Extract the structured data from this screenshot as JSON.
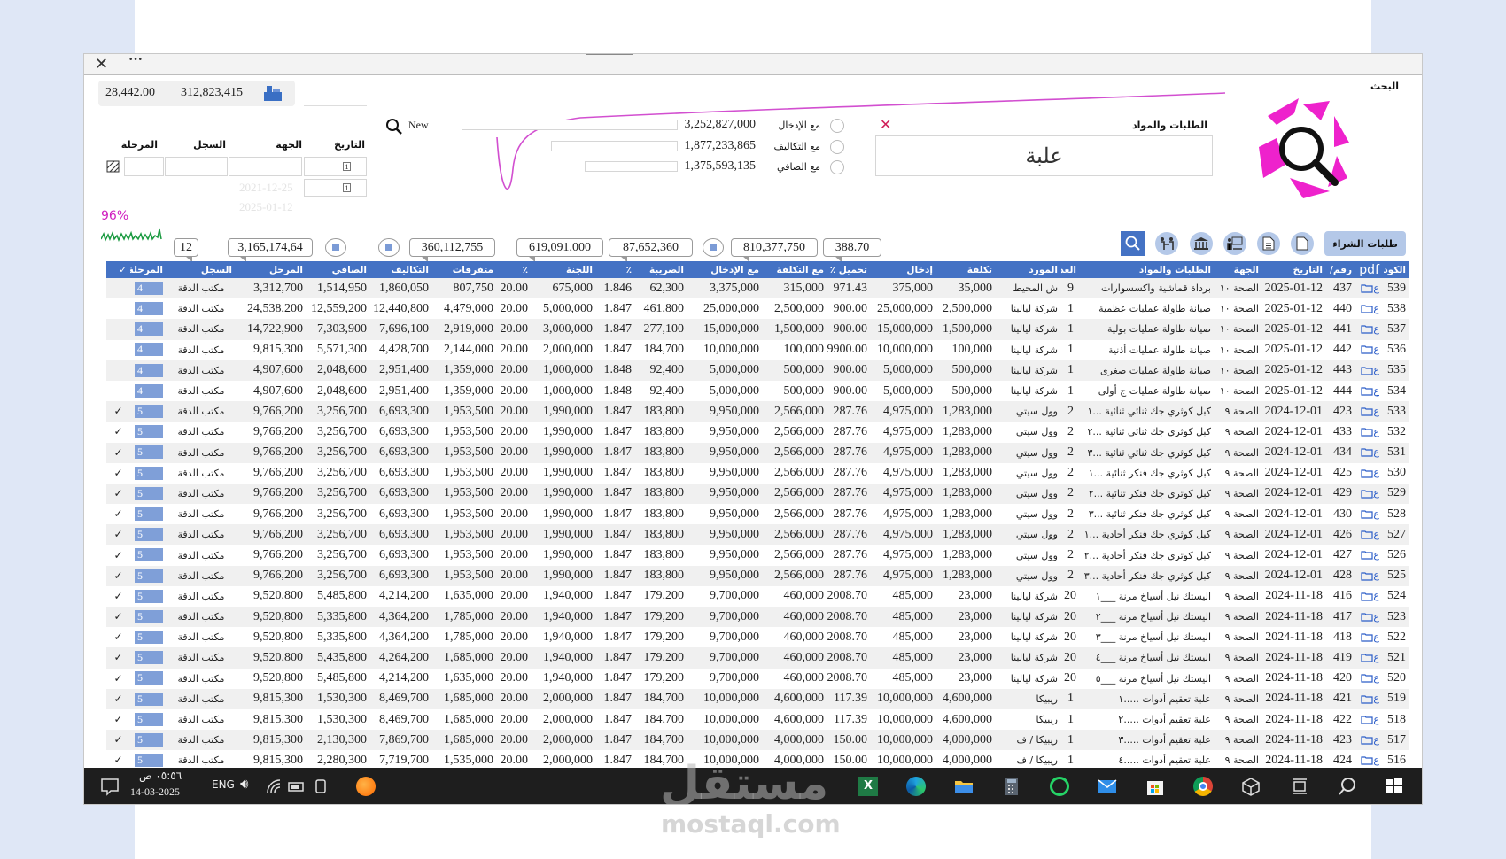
{
  "window": {
    "close_icon": "close-icon",
    "more_icon": "more-icon"
  },
  "search_panel": {
    "title": "البحث",
    "field_label": "الطلبات والمواد",
    "query": "علبة",
    "clear_icon": "x-icon"
  },
  "totals": {
    "radios": [
      {
        "label": "مع الإدخال",
        "value": "3,252,827,000"
      },
      {
        "label": "مع التكاليف",
        "value": "1,877,233,865"
      },
      {
        "label": "مع الصافي",
        "value": "1,375,593,135"
      }
    ],
    "new_label": "New"
  },
  "summary_top": {
    "value1": "28,442.00",
    "value2": "312,823,415"
  },
  "filters": {
    "date_label": "التاريخ",
    "party_label": "الجهة",
    "register_label": "السجل",
    "stage_label": "المرحلة",
    "date_from_hint": "2021-12-25",
    "date_to_hint": "2025-01-12",
    "cal1": "1",
    "cal2": "1"
  },
  "progress": {
    "label": "96%",
    "value": 96
  },
  "sums": {
    "count": "12",
    "carried": "3,165,174,64",
    "costs": "360,112,755",
    "committee": "619,091,000",
    "tax": "87,652,360",
    "with_entry": "810,377,750",
    "load": "388.70"
  },
  "toolbar": {
    "purchase_label": "طلبات الشراء"
  },
  "colors": {
    "header": "#4472c4",
    "accent": "#e020c0",
    "stage": "#7f9fd8"
  },
  "table": {
    "columns": [
      "الكود",
      "pdf",
      "رقم/ ف",
      "التاريخ",
      "الجهة",
      "الطلبات والمواد",
      "العدد",
      "المورد",
      "تكلفة",
      "إدخال",
      "تحميل ٪",
      "مع التكلفة",
      "مع الإدخال",
      "الضريبة",
      "٪",
      "اللجنة",
      "٪",
      "متفرقات",
      "التكاليف",
      "الصافي",
      "المرحل",
      "السجل",
      "المرحلة",
      "✓"
    ],
    "pdf_text": "ع",
    "rows": [
      [
        "539",
        "437",
        "2025-01-12",
        "الصحة ١٠",
        "برداة قماشية واكسسوارات",
        "9",
        "ش المحيط",
        "35,000",
        "375,000",
        "971.43",
        "315,000",
        "3,375,000",
        "62,300",
        "1.846",
        "675,000",
        "20.00",
        "807,750",
        "1,860,050",
        "1,514,950",
        "3,312,700",
        "مكتب الدقة",
        "4",
        ""
      ],
      [
        "538",
        "440",
        "2025-01-12",
        "الصحة ١٠",
        "صيانة طاولة عمليات عظمية",
        "1",
        "شركة ليالينا",
        "2,500,000",
        "25,000,000",
        "900.00",
        "2,500,000",
        "25,000,000",
        "461,800",
        "1.847",
        "5,000,000",
        "20.00",
        "4,479,000",
        "12,440,800",
        "12,559,200",
        "24,538,200",
        "مكتب الدقة",
        "4",
        ""
      ],
      [
        "537",
        "441",
        "2025-01-12",
        "الصحة ١٠",
        "صيانة طاولة عمليات بولية",
        "1",
        "شركة ليالينا",
        "1,500,000",
        "15,000,000",
        "900.00",
        "1,500,000",
        "15,000,000",
        "277,100",
        "1.847",
        "3,000,000",
        "20.00",
        "2,919,000",
        "7,696,100",
        "7,303,900",
        "14,722,900",
        "مكتب الدقة",
        "4",
        ""
      ],
      [
        "536",
        "442",
        "2025-01-12",
        "الصحة ١٠",
        "صيانة طاولة عمليات أذنية",
        "1",
        "شركة ليالينا",
        "100,000",
        "10,000,000",
        "9900.00",
        "100,000",
        "10,000,000",
        "184,700",
        "1.847",
        "2,000,000",
        "20.00",
        "2,144,000",
        "4,428,700",
        "5,571,300",
        "9,815,300",
        "مكتب الدقة",
        "4",
        ""
      ],
      [
        "535",
        "443",
        "2025-01-12",
        "الصحة ١٠",
        "صيانة طاولة عمليات صغرى",
        "1",
        "شركة ليالينا",
        "500,000",
        "5,000,000",
        "900.00",
        "500,000",
        "5,000,000",
        "92,400",
        "1.848",
        "1,000,000",
        "20.00",
        "1,359,000",
        "2,951,400",
        "2,048,600",
        "4,907,600",
        "مكتب الدقة",
        "4",
        ""
      ],
      [
        "534",
        "444",
        "2025-01-12",
        "الصحة ١٠",
        "صيانة طاولة عمليات ج أولى",
        "1",
        "شركة ليالينا",
        "500,000",
        "5,000,000",
        "900.00",
        "500,000",
        "5,000,000",
        "92,400",
        "1.848",
        "1,000,000",
        "20.00",
        "1,359,000",
        "2,951,400",
        "2,048,600",
        "4,907,600",
        "مكتب الدقة",
        "4",
        ""
      ],
      [
        "533",
        "423",
        "2024-12-01",
        "الصحة ٩",
        "كبل كوثري جك ثنائي ثنائية ...١",
        "2",
        "وول سيتي",
        "1,283,000",
        "4,975,000",
        "287.76",
        "2,566,000",
        "9,950,000",
        "183,800",
        "1.847",
        "1,990,000",
        "20.00",
        "1,953,500",
        "6,693,300",
        "3,256,700",
        "9,766,200",
        "مكتب الدقة",
        "5",
        "✓"
      ],
      [
        "532",
        "433",
        "2024-12-01",
        "الصحة ٩",
        "كبل كوثري جك ثنائي ثنائية ...٢",
        "2",
        "وول سيتي",
        "1,283,000",
        "4,975,000",
        "287.76",
        "2,566,000",
        "9,950,000",
        "183,800",
        "1.847",
        "1,990,000",
        "20.00",
        "1,953,500",
        "6,693,300",
        "3,256,700",
        "9,766,200",
        "مكتب الدقة",
        "5",
        "✓"
      ],
      [
        "531",
        "434",
        "2024-12-01",
        "الصحة ٩",
        "كبل كوثري جك ثنائي ثنائية ...٣",
        "2",
        "وول سيتي",
        "1,283,000",
        "4,975,000",
        "287.76",
        "2,566,000",
        "9,950,000",
        "183,800",
        "1.847",
        "1,990,000",
        "20.00",
        "1,953,500",
        "6,693,300",
        "3,256,700",
        "9,766,200",
        "مكتب الدقة",
        "5",
        "✓"
      ],
      [
        "530",
        "425",
        "2024-12-01",
        "الصحة ٩",
        "كبل كوثري جك فنكر ثنائية ...١",
        "2",
        "وول سيتي",
        "1,283,000",
        "4,975,000",
        "287.76",
        "2,566,000",
        "9,950,000",
        "183,800",
        "1.847",
        "1,990,000",
        "20.00",
        "1,953,500",
        "6,693,300",
        "3,256,700",
        "9,766,200",
        "مكتب الدقة",
        "5",
        "✓"
      ],
      [
        "529",
        "429",
        "2024-12-01",
        "الصحة ٩",
        "كبل كوثري جك فنكر ثنائية ...٢",
        "2",
        "وول سيتي",
        "1,283,000",
        "4,975,000",
        "287.76",
        "2,566,000",
        "9,950,000",
        "183,800",
        "1.847",
        "1,990,000",
        "20.00",
        "1,953,500",
        "6,693,300",
        "3,256,700",
        "9,766,200",
        "مكتب الدقة",
        "5",
        "✓"
      ],
      [
        "528",
        "430",
        "2024-12-01",
        "الصحة ٩",
        "كبل كوثري جك فنكر ثنائية ...٣",
        "2",
        "وول سيتي",
        "1,283,000",
        "4,975,000",
        "287.76",
        "2,566,000",
        "9,950,000",
        "183,800",
        "1.847",
        "1,990,000",
        "20.00",
        "1,953,500",
        "6,693,300",
        "3,256,700",
        "9,766,200",
        "مكتب الدقة",
        "5",
        "✓"
      ],
      [
        "527",
        "426",
        "2024-12-01",
        "الصحة ٩",
        "كبل كوثري جك فنكر أحادية ...١",
        "2",
        "وول سيتي",
        "1,283,000",
        "4,975,000",
        "287.76",
        "2,566,000",
        "9,950,000",
        "183,800",
        "1.847",
        "1,990,000",
        "20.00",
        "1,953,500",
        "6,693,300",
        "3,256,700",
        "9,766,200",
        "مكتب الدقة",
        "5",
        "✓"
      ],
      [
        "526",
        "427",
        "2024-12-01",
        "الصحة ٩",
        "كبل كوثري جك فنكر أحادية ...٢",
        "2",
        "وول سيتي",
        "1,283,000",
        "4,975,000",
        "287.76",
        "2,566,000",
        "9,950,000",
        "183,800",
        "1.847",
        "1,990,000",
        "20.00",
        "1,953,500",
        "6,693,300",
        "3,256,700",
        "9,766,200",
        "مكتب الدقة",
        "5",
        "✓"
      ],
      [
        "525",
        "428",
        "2024-12-01",
        "الصحة ٩",
        "كبل كوثري جك فنكر أحادية ...٣",
        "2",
        "وول سيتي",
        "1,283,000",
        "4,975,000",
        "287.76",
        "2,566,000",
        "9,950,000",
        "183,800",
        "1.847",
        "1,990,000",
        "20.00",
        "1,953,500",
        "6,693,300",
        "3,256,700",
        "9,766,200",
        "مكتب الدقة",
        "5",
        "✓"
      ],
      [
        "524",
        "416",
        "2024-11-18",
        "الصحة ٩",
        "اليستك نيل أسياخ مرنة ___١",
        "20",
        "شركة ليالينا",
        "23,000",
        "485,000",
        "2008.70",
        "460,000",
        "9,700,000",
        "179,200",
        "1.847",
        "1,940,000",
        "20.00",
        "1,635,000",
        "4,214,200",
        "5,485,800",
        "9,520,800",
        "مكتب الدقة",
        "5",
        "✓"
      ],
      [
        "523",
        "417",
        "2024-11-18",
        "الصحة ٩",
        "اليستك نيل أسياخ مرنة ___٢",
        "20",
        "شركة ليالينا",
        "23,000",
        "485,000",
        "2008.70",
        "460,000",
        "9,700,000",
        "179,200",
        "1.847",
        "1,940,000",
        "20.00",
        "1,785,000",
        "4,364,200",
        "5,335,800",
        "9,520,800",
        "مكتب الدقة",
        "5",
        "✓"
      ],
      [
        "522",
        "418",
        "2024-11-18",
        "الصحة ٩",
        "اليستك نيل أسياخ مرنة ___٣",
        "20",
        "شركة ليالينا",
        "23,000",
        "485,000",
        "2008.70",
        "460,000",
        "9,700,000",
        "179,200",
        "1.847",
        "1,940,000",
        "20.00",
        "1,785,000",
        "4,364,200",
        "5,335,800",
        "9,520,800",
        "مكتب الدقة",
        "5",
        "✓"
      ],
      [
        "521",
        "419",
        "2024-11-18",
        "الصحة ٩",
        "اليستك نيل أسياخ مرنة ___٤",
        "20",
        "شركة ليالينا",
        "23,000",
        "485,000",
        "2008.70",
        "460,000",
        "9,700,000",
        "179,200",
        "1.847",
        "1,940,000",
        "20.00",
        "1,685,000",
        "4,264,200",
        "5,435,800",
        "9,520,800",
        "مكتب الدقة",
        "5",
        "✓"
      ],
      [
        "520",
        "420",
        "2024-11-18",
        "الصحة ٩",
        "اليستك نيل أسياخ مرنة ___٥",
        "20",
        "شركة ليالينا",
        "23,000",
        "485,000",
        "2008.70",
        "460,000",
        "9,700,000",
        "179,200",
        "1.847",
        "1,940,000",
        "20.00",
        "1,635,000",
        "4,214,200",
        "5,485,800",
        "9,520,800",
        "مكتب الدقة",
        "5",
        "✓"
      ],
      [
        "519",
        "421",
        "2024-11-18",
        "الصحة ٩",
        "علبة تعقيم أدوات .....١",
        "1",
        "ريبيكا",
        "4,600,000",
        "10,000,000",
        "117.39",
        "4,600,000",
        "10,000,000",
        "184,700",
        "1.847",
        "2,000,000",
        "20.00",
        "1,685,000",
        "8,469,700",
        "1,530,300",
        "9,815,300",
        "مكتب الدقة",
        "5",
        "✓"
      ],
      [
        "518",
        "422",
        "2024-11-18",
        "الصحة ٩",
        "علبة تعقيم أدوات .....٢",
        "1",
        "ريبيكا",
        "4,600,000",
        "10,000,000",
        "117.39",
        "4,600,000",
        "10,000,000",
        "184,700",
        "1.847",
        "2,000,000",
        "20.00",
        "1,685,000",
        "8,469,700",
        "1,530,300",
        "9,815,300",
        "مكتب الدقة",
        "5",
        "✓"
      ],
      [
        "517",
        "423",
        "2024-11-18",
        "الصحة ٩",
        "علبة تعقيم أدوات .....٣",
        "1",
        "ريبيكا / ف",
        "4,000,000",
        "10,000,000",
        "150.00",
        "4,000,000",
        "10,000,000",
        "184,700",
        "1.847",
        "2,000,000",
        "20.00",
        "1,685,000",
        "7,869,700",
        "2,130,300",
        "9,815,300",
        "مكتب الدقة",
        "5",
        "✓"
      ],
      [
        "516",
        "424",
        "2024-11-18",
        "الصحة ٩",
        "علبة تعقيم أدوات .....٤",
        "1",
        "ريبيكا / ف",
        "4,000,000",
        "10,000,000",
        "150.00",
        "4,000,000",
        "10,000,000",
        "184,700",
        "1.847",
        "2,000,000",
        "20.00",
        "1,535,000",
        "7,719,700",
        "2,280,300",
        "9,815,300",
        "مكتب الدقة",
        "5",
        "✓"
      ]
    ]
  },
  "taskbar": {
    "time": "٠٥:٥٦ ص",
    "date": "14-03-2025",
    "lang": "ENG"
  },
  "watermark": {
    "text_ar": "مستقل",
    "text_en": "mostaql.com"
  }
}
